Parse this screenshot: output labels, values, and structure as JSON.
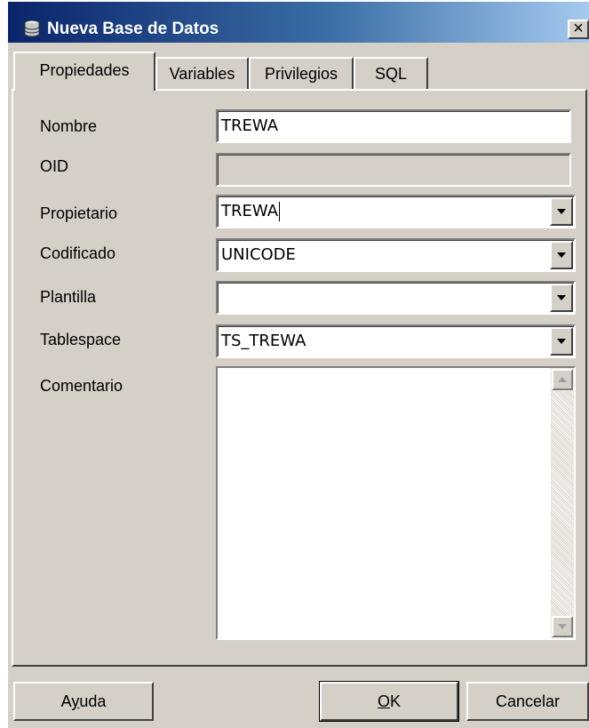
{
  "window": {
    "title": "Nueva Base de Datos",
    "close_glyph": "×",
    "icon": "database-icon"
  },
  "tabs": [
    {
      "label": "Propiedades",
      "active": true
    },
    {
      "label": "Variables",
      "active": false
    },
    {
      "label": "Privilegios",
      "active": false
    },
    {
      "label": "SQL",
      "active": false
    }
  ],
  "form": {
    "nombre": {
      "label": "Nombre",
      "value": "TREWA"
    },
    "oid": {
      "label": "OID",
      "value": ""
    },
    "propietario": {
      "label": "Propietario",
      "value": "TREWA"
    },
    "codificado": {
      "label": "Codificado",
      "value": "UNICODE"
    },
    "plantilla": {
      "label": "Plantilla",
      "value": ""
    },
    "tablespace": {
      "label": "Tablespace",
      "value": "TS_TREWA"
    },
    "comentario": {
      "label": "Comentario",
      "value": ""
    }
  },
  "buttons": {
    "help": {
      "first": "A",
      "accel": "y",
      "rest": "uda"
    },
    "ok": {
      "accel": "O",
      "rest": "K"
    },
    "cancel": {
      "label": "Cancelar"
    }
  },
  "colors": {
    "titlebar_start": "#0a246a",
    "titlebar_end": "#a6caf0",
    "face": "#d4d0c8"
  }
}
